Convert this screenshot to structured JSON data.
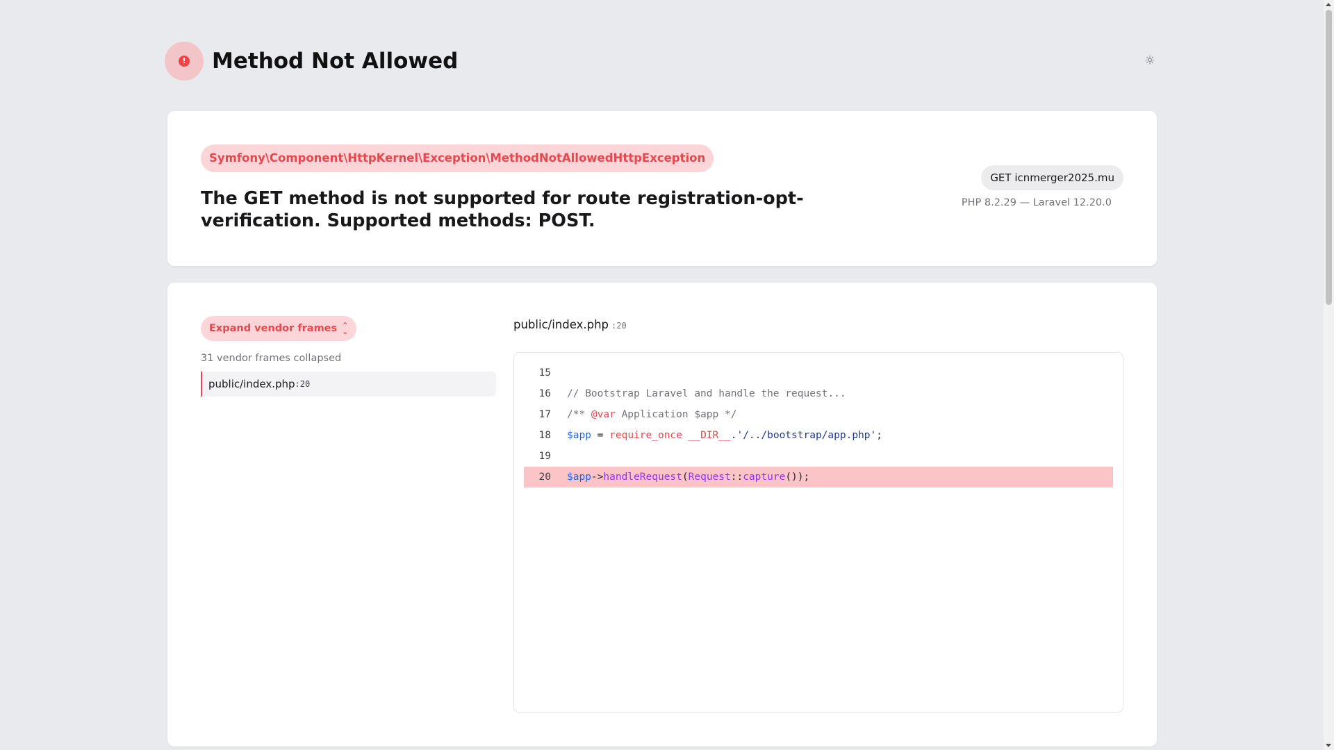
{
  "header": {
    "title": "Method Not Allowed",
    "alert_icon_glyph": "!",
    "theme_icon": "sun-icon",
    "theme_glyph": "☼"
  },
  "exception": {
    "class": "Symfony\\Component\\HttpKernel\\Exception\\MethodNotAllowedHttpException",
    "message": "The GET method is not supported for route registration-opt-verification. Supported methods: POST.",
    "request": "GET icnmerger2025.mu",
    "versions": "PHP 8.2.29 — Laravel 12.20.0"
  },
  "trace": {
    "expand_label": "Expand vendor frames",
    "collapsed_note": "31 vendor frames collapsed",
    "frames": [
      {
        "file": "public/index.php",
        "line": ":20"
      }
    ]
  },
  "code": {
    "file": "public/index.php",
    "line": ":20",
    "highlight_line": 20,
    "rows": [
      {
        "n": "15",
        "tokens": []
      },
      {
        "n": "16",
        "tokens": [
          {
            "t": "// Bootstrap Laravel and handle the request...",
            "c": "comment"
          }
        ]
      },
      {
        "n": "17",
        "tokens": [
          {
            "t": "/** ",
            "c": "comment"
          },
          {
            "t": "@var",
            "c": "tag"
          },
          {
            "t": " Application $app */",
            "c": "comment"
          }
        ]
      },
      {
        "n": "18",
        "tokens": [
          {
            "t": "$app",
            "c": "var"
          },
          {
            "t": " = ",
            "c": ""
          },
          {
            "t": "require_once",
            "c": "kw"
          },
          {
            "t": " ",
            "c": ""
          },
          {
            "t": "__DIR__",
            "c": "kw"
          },
          {
            "t": ".",
            "c": ""
          },
          {
            "t": "'/../bootstrap/app.php'",
            "c": "str"
          },
          {
            "t": ";",
            "c": ""
          }
        ]
      },
      {
        "n": "19",
        "tokens": []
      },
      {
        "n": "20",
        "tokens": [
          {
            "t": "$app",
            "c": "var"
          },
          {
            "t": "->",
            "c": ""
          },
          {
            "t": "handleRequest",
            "c": "fn"
          },
          {
            "t": "(",
            "c": ""
          },
          {
            "t": "Request",
            "c": "fn"
          },
          {
            "t": "::",
            "c": ""
          },
          {
            "t": "capture",
            "c": "fn"
          },
          {
            "t": "());",
            "c": ""
          }
        ]
      }
    ]
  },
  "colors": {
    "accent": "#e5484d",
    "accent_bg": "#fbd5d8",
    "highlight_row": "#fbc4c7",
    "page_bg": "#e9eaee"
  }
}
